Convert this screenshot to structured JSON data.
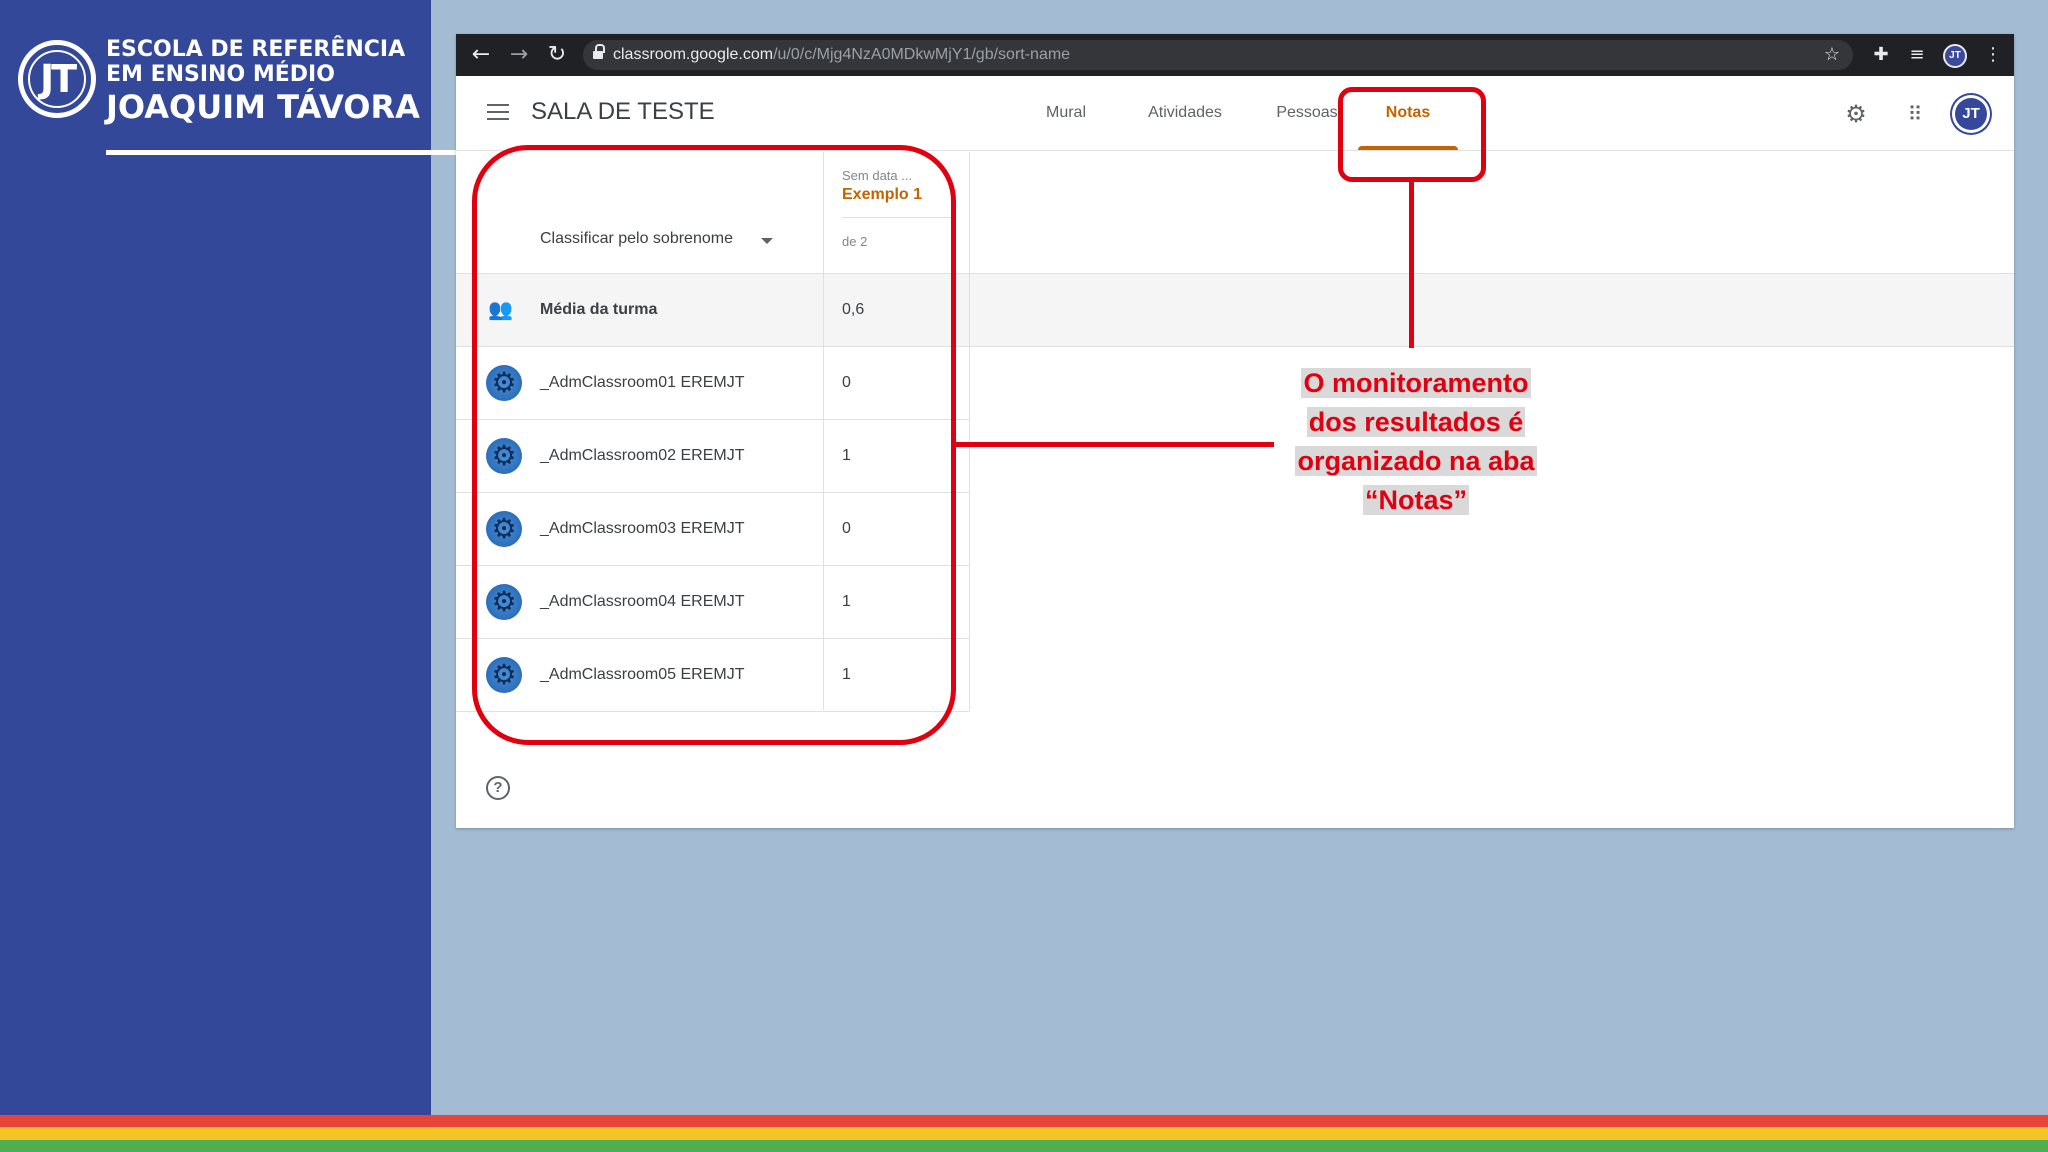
{
  "school": {
    "logo": "JT",
    "line1": "ESCOLA DE REFERÊNCIA",
    "line2": "EM ENSINO MÉDIO",
    "line3": "JOAQUIM TÁVORA"
  },
  "browser": {
    "url_domain": "classroom.google.com",
    "url_path": "/u/0/c/Mjg4NzA0MDkwMjY1/gb/sort-name",
    "icons": {
      "back": "arrow-left-icon",
      "forward": "arrow-right-icon",
      "reload": "reload-icon",
      "bookmark": "star-icon",
      "extensions": "puzzle-icon",
      "reading_list": "reading-list-icon",
      "menu": "kebab-menu-icon"
    },
    "profile_initials": "JT"
  },
  "classroom": {
    "class_title": "SALA DE TESTE",
    "tabs": [
      {
        "label": "Mural",
        "active": false
      },
      {
        "label": "Atividades",
        "active": false
      },
      {
        "label": "Pessoas",
        "active": false
      },
      {
        "label": "Notas",
        "active": true
      }
    ],
    "avatar_initials": "JT",
    "accent_color": "#c26401"
  },
  "grades": {
    "sort_label": "Classificar pelo sobrenome",
    "assignment": {
      "date": "Sem data ...",
      "name": "Exemplo 1",
      "max_points": "de 2"
    },
    "class_average": {
      "label": "Média da turma",
      "value": "0,6"
    },
    "students": [
      {
        "name": "_AdmClassroom01 EREMJT",
        "grade": "0"
      },
      {
        "name": "_AdmClassroom02 EREMJT",
        "grade": "1"
      },
      {
        "name": "_AdmClassroom03 EREMJT",
        "grade": "0"
      },
      {
        "name": "_AdmClassroom04 EREMJT",
        "grade": "1"
      },
      {
        "name": "_AdmClassroom05 EREMJT",
        "grade": "1"
      }
    ]
  },
  "annotation": {
    "line1": "O monitoramento",
    "line2": "dos resultados é",
    "line3": "organizado na aba",
    "line4": "“Notas”",
    "color": "#e0000f"
  },
  "stripe_colors": [
    "#e8443a",
    "#f6c324",
    "#4daf50"
  ]
}
